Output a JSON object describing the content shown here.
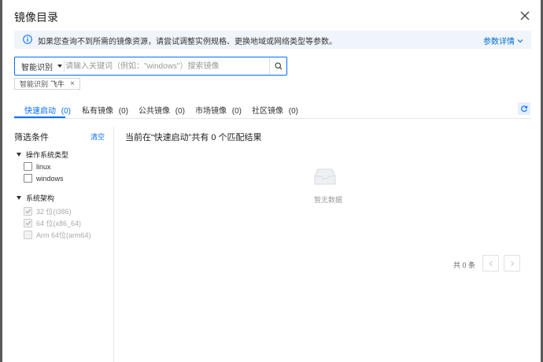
{
  "dialog": {
    "title": "镜像目录"
  },
  "info_bar": {
    "text": "如果您查询不到所需的镜像资源，请尝试调整实例规格、更换地域或网络类型等参数。",
    "link_label": "参数详情"
  },
  "search": {
    "type_label": "智能识别",
    "placeholder": "请输入关键词（例如：\"windows\"）搜索镜像",
    "value": ""
  },
  "filter_tag": {
    "key": "智能识别",
    "value": "飞牛"
  },
  "tabs": [
    {
      "label": "快速启动",
      "count": "(0)",
      "active": true
    },
    {
      "label": "私有镜像",
      "count": "(0)",
      "active": false
    },
    {
      "label": "公共镜像",
      "count": "(0)",
      "active": false
    },
    {
      "label": "市场镜像",
      "count": "(0)",
      "active": false
    },
    {
      "label": "社区镜像",
      "count": "(0)",
      "active": false
    }
  ],
  "sidebar": {
    "title": "筛选条件",
    "clear_label": "清空",
    "groups": [
      {
        "label": "操作系统类型",
        "options": [
          {
            "label": "linux",
            "checked": false,
            "disabled": false
          },
          {
            "label": "windows",
            "checked": false,
            "disabled": false
          }
        ]
      },
      {
        "label": "系统架构",
        "options": [
          {
            "label": "32 位(i386)",
            "checked": true,
            "disabled": true
          },
          {
            "label": "64 位(x86_64)",
            "checked": true,
            "disabled": true
          },
          {
            "label": "Arm 64位(arm64)",
            "checked": false,
            "disabled": true
          }
        ]
      }
    ]
  },
  "results": {
    "summary": "当前在“快速启动”共有 0 个匹配结果",
    "empty_text": "暂无数据"
  },
  "pagination": {
    "total_text": "共 0 条"
  },
  "colors": {
    "accent": "#006eff",
    "info_bg": "#f0f4fb"
  }
}
